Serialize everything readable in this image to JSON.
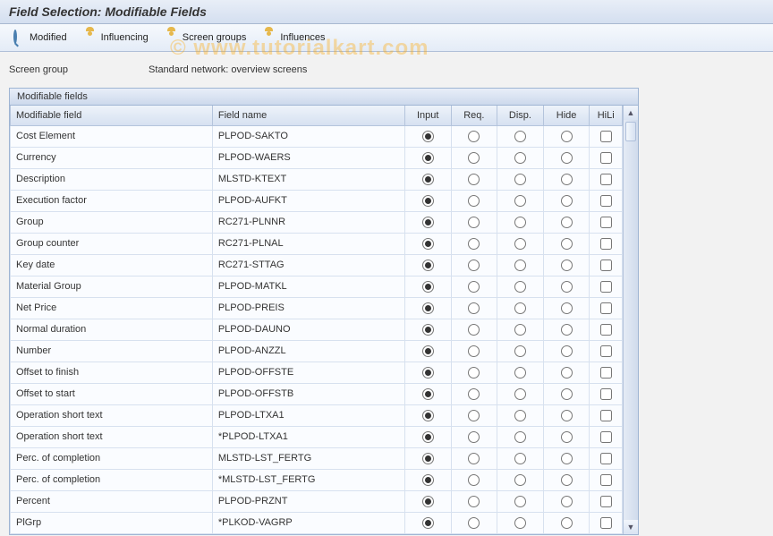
{
  "title": "Field Selection: Modifiable Fields",
  "toolbar": {
    "modified": "Modified",
    "influencing": "Influencing",
    "screen_groups": "Screen groups",
    "influences": "Influences"
  },
  "header": {
    "label": "Screen group",
    "value": "Standard network: overview screens"
  },
  "panel": {
    "title": "Modifiable fields",
    "columns": {
      "modifiable_field": "Modifiable field",
      "field_name": "Field name",
      "input": "Input",
      "req": "Req.",
      "disp": "Disp.",
      "hide": "Hide",
      "hili": "HiLi"
    },
    "rows": [
      {
        "label": "Cost Element",
        "field": "PLPOD-SAKTO",
        "sel": "input",
        "hili": false
      },
      {
        "label": "Currency",
        "field": "PLPOD-WAERS",
        "sel": "input",
        "hili": false
      },
      {
        "label": "Description",
        "field": "MLSTD-KTEXT",
        "sel": "input",
        "hili": false
      },
      {
        "label": "Execution factor",
        "field": "PLPOD-AUFKT",
        "sel": "input",
        "hili": false
      },
      {
        "label": "Group",
        "field": "RC271-PLNNR",
        "sel": "input",
        "hili": false
      },
      {
        "label": "Group counter",
        "field": "RC271-PLNAL",
        "sel": "input",
        "hili": false
      },
      {
        "label": "Key date",
        "field": "RC271-STTAG",
        "sel": "input",
        "hili": false
      },
      {
        "label": "Material Group",
        "field": "PLPOD-MATKL",
        "sel": "input",
        "hili": false
      },
      {
        "label": "Net Price",
        "field": "PLPOD-PREIS",
        "sel": "input",
        "hili": false
      },
      {
        "label": "Normal duration",
        "field": "PLPOD-DAUNO",
        "sel": "input",
        "hili": false
      },
      {
        "label": "Number",
        "field": "PLPOD-ANZZL",
        "sel": "input",
        "hili": false
      },
      {
        "label": "Offset to finish",
        "field": "PLPOD-OFFSTE",
        "sel": "input",
        "hili": false
      },
      {
        "label": "Offset to start",
        "field": "PLPOD-OFFSTB",
        "sel": "input",
        "hili": false
      },
      {
        "label": "Operation short text",
        "field": "PLPOD-LTXA1",
        "sel": "input",
        "hili": false
      },
      {
        "label": "Operation short text",
        "field": "*PLPOD-LTXA1",
        "sel": "input",
        "hili": false
      },
      {
        "label": "Perc. of completion",
        "field": "MLSTD-LST_FERTG",
        "sel": "input",
        "hili": false
      },
      {
        "label": "Perc. of completion",
        "field": "*MLSTD-LST_FERTG",
        "sel": "input",
        "hili": false
      },
      {
        "label": "Percent",
        "field": "PLPOD-PRZNT",
        "sel": "input",
        "hili": false
      },
      {
        "label": "PlGrp",
        "field": "*PLKOD-VAGRP",
        "sel": "input",
        "hili": false
      }
    ]
  }
}
